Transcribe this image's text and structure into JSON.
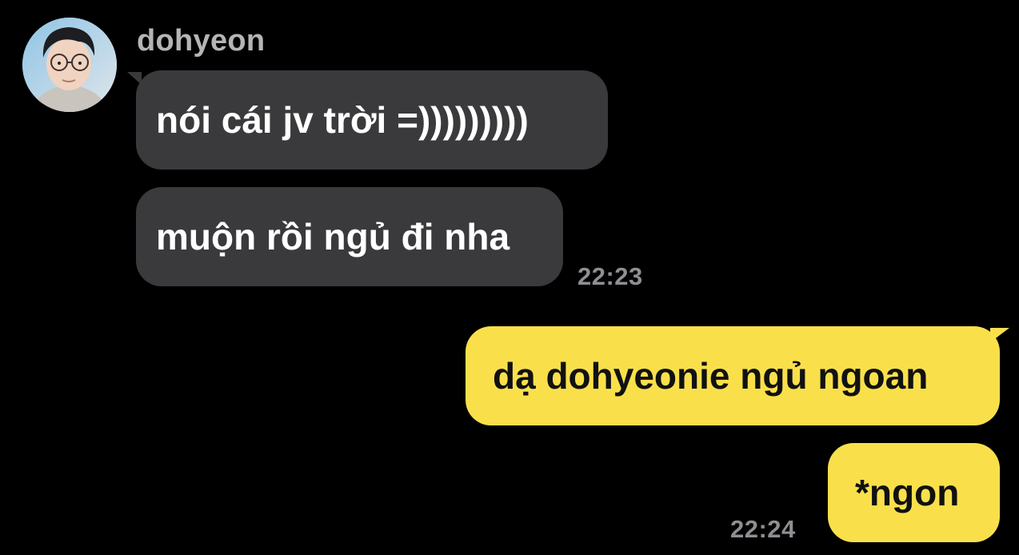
{
  "chat": {
    "sender_name": "dohyeon",
    "incoming": [
      {
        "text": "nói cái jv trời =)))))))))"
      },
      {
        "text": "muộn rồi ngủ đi nha"
      }
    ],
    "incoming_time": "22:23",
    "outgoing": [
      {
        "text": "dạ dohyeonie ngủ ngoan"
      },
      {
        "text": "*ngon"
      }
    ],
    "outgoing_time": "22:24"
  },
  "colors": {
    "background": "#000000",
    "incoming_bubble": "#3a3a3c",
    "outgoing_bubble": "#f9e04b",
    "timestamp": "#8e8e93"
  },
  "icons": {
    "avatar": "profile-photo"
  }
}
